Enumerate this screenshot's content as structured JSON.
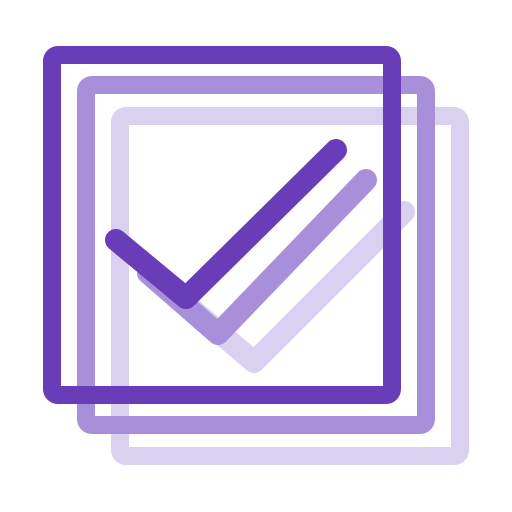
{
  "icon": {
    "name": "stacked-checkbox-icon",
    "colors": {
      "front": "#6A3DB8",
      "middle": "#A88FD9",
      "back": "#DAD0F0",
      "background": "#FFFFFF"
    }
  }
}
